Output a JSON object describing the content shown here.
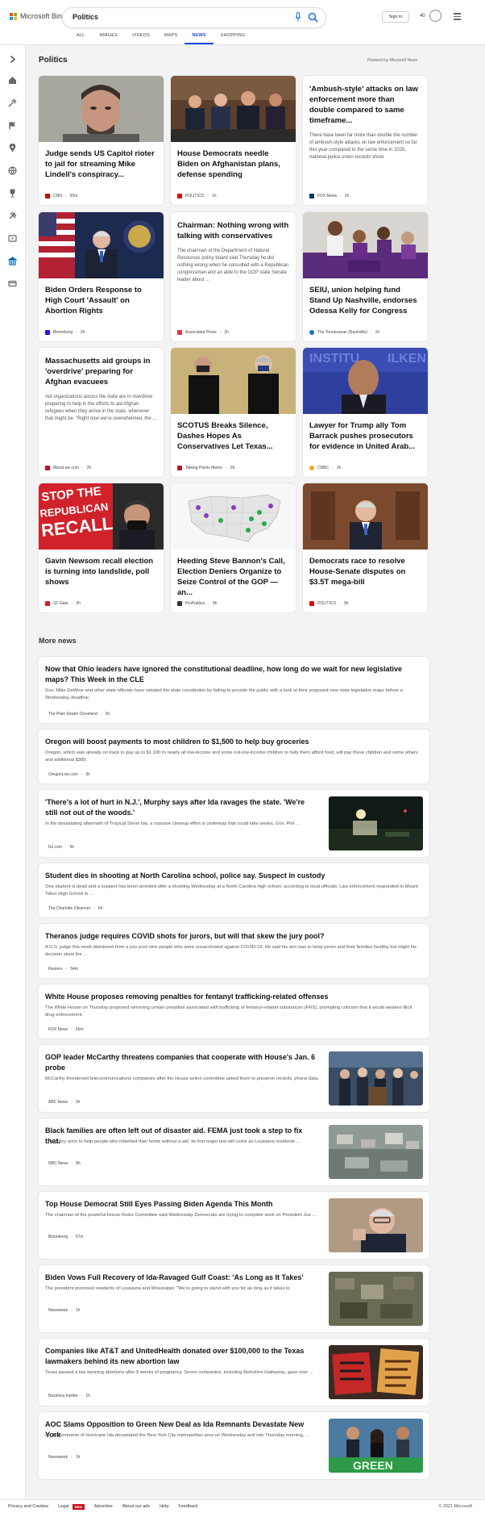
{
  "header": {
    "brand": "Microsoft Bing",
    "query": "Politics",
    "signin": "Sign in",
    "points": "40",
    "tabs": [
      "ALL",
      "IMAGES",
      "VIDEOS",
      "MAPS",
      "NEWS",
      "SHOPPING"
    ],
    "active_tab": "NEWS"
  },
  "section": {
    "title": "Politics",
    "powered_by": "Powered by Microsoft News"
  },
  "cards": [
    {
      "title": "Judge sends US Capitol rioter to jail for streaming Mike Lindell's conspiracy...",
      "source": "CNN",
      "time": "55m",
      "fav": "#cc0000",
      "img": "mugshot"
    },
    {
      "title": "House Democrats needle Biden on Afghanistan plans, defense spending",
      "source": "POLITICO",
      "time": "1h",
      "fav": "#d00",
      "img": "hearing"
    },
    {
      "title": "'Ambush-style' attacks on law enforcement more than double compared to same timeframe...",
      "snippet": "There have been far more than double the number of ambush-style attacks on law enforcement so far this year compared to the same time in 2020, national police union records show.",
      "source": "FOX News",
      "time": "2h",
      "fav": "#003366"
    },
    {
      "title": "Biden Orders Response to High Court 'Assault' on Abortion Rights",
      "source": "Bloomberg",
      "time": "2h",
      "fav": "#3a00ff",
      "img": "biden"
    },
    {
      "title": "Chairman: Nothing wrong with talking with conservatives",
      "snippet": "The chairman of the Department of Natural Resources policy board said Thursday he did nothing wrong when he consulted with a Republican congressman and an aide to the GOP state Senate leader about ...",
      "source": "Associated Press",
      "time": "2h",
      "fav": "#e03a3e"
    },
    {
      "title": "SEIU, union helping fund Stand Up Nashville, endorses Odessa Kelly for Congress",
      "source": "The Tennessean (Nashville)",
      "time": "1h",
      "fav": "#1a6fd1",
      "img": "rally"
    },
    {
      "title": "Massachusetts aid groups in 'overdrive' preparing for Afghan evacuees",
      "snippet": "Aid organizations across the state are in overdrive preparing to help in the efforts to aid Afghan refugees when they arrive in the state, whenever that might be. \"Right now we're overwhelmed, the ...",
      "source": "MassLive.com",
      "time": "2h",
      "fav": "#c8102e"
    },
    {
      "title": "SCOTUS Breaks Silence, Dashes Hopes As Conservatives Let Texas...",
      "source": "Talking Points Memo",
      "time": "2h",
      "fav": "#b01e23",
      "img": "scotus"
    },
    {
      "title": "Lawyer for Trump ally Tom Barrack pushes prosecutors for evidence in United Arab...",
      "source": "CNBC",
      "time": "2h",
      "fav": "#f5a623",
      "img": "barrack"
    },
    {
      "title": "Gavin Newsom recall election is turning into landslide, poll shows",
      "source": "SF Gate",
      "time": "3h",
      "fav": "#d71920",
      "img": "recall"
    },
    {
      "title": "Heeding Steve Bannon's Call, Election Deniers Organize to Seize Control of the GOP — an...",
      "source": "ProPublica",
      "time": "9h",
      "fav": "#333333",
      "img": "map"
    },
    {
      "title": "Democrats race to resolve House-Senate disputes on $3.5T mega-bill",
      "source": "POLITICO",
      "time": "9h",
      "fav": "#d00",
      "img": "wyden"
    }
  ],
  "more": {
    "title": "More news",
    "items": [
      {
        "title": "Now that Ohio leaders have ignored the constitutional deadline, how long do we wait for new legislative maps? This Week in the CLE",
        "snippet": "Gov. Mike DeWine and other state officials have violated the state constitution by failing to provide the public with a look at their proposed new state legislative maps before a Wednesday deadline.",
        "source": "The Plain Dealer Cleveland",
        "time": "3h",
        "fav": "#1b4f8a"
      },
      {
        "title": "Oregon will boost payments to most children to $1,500 to help buy groceries",
        "snippet": "Oregon, which was already on track to pay up to $1,100 to nearly all low-income and some not-low-income children to help them afford food, will pay those children and some others and additional $389.",
        "source": "OregonLive.com",
        "time": "3h",
        "fav": "#222222"
      },
      {
        "title": "'There's a lot of hurt in N.J.', Murphy says after Ida ravages the state. 'We're still not out of the woods.'",
        "snippet": "In the devastating aftermath of Tropical Storm Ida, a massive cleanup effort is underway that could take weeks, Gov. Phil ...",
        "source": "NJ.com",
        "time": "5h",
        "fav": "#444444",
        "img": "flood-night"
      },
      {
        "title": "Student dies in shooting at North Carolina school, police say. Suspect in custody",
        "snippet": "One student is dead and a suspect has been arrested after a shooting Wednesday at a North Carolina high school, according to local officials. Law enforcement responded to Mount Tabor High School in ...",
        "source": "The Charlotte Observer",
        "time": "6h",
        "fav": "#1f74c7"
      },
      {
        "title": "Theranos judge requires COVID shots for jurors, but will that skew the jury pool?",
        "snippet": "A U.S. judge this week dismissed from a jury pool nine people who were unvaccinated against COVID-19. He said his aim was to keep jurors and their families healthy but might his decision skew the ...",
        "source": "Reuters",
        "time": "54m",
        "fav": "#ff8000"
      },
      {
        "title": "White House proposes removing penalties for fentanyl trafficking-related offenses",
        "snippet": "The White House on Thursday proposed removing certain penalties associated with trafficking of fentanyl-related substances (FRS), prompting criticism that it would weaken illicit drug enforcement.",
        "source": "FOX News",
        "time": "55m",
        "fav": "#003366"
      },
      {
        "title": "GOP leader McCarthy threatens companies that cooperate with House's Jan. 6 probe",
        "snippet": "McCarthy threatened telecommunications companies after the House select committee asked them to preserve records, phone data.",
        "source": "ABC News",
        "time": "3h",
        "fav": "#111111",
        "img": "podium"
      },
      {
        "title": "Black families are often left out of disaster aid. FEMA just took a step to fix that.",
        "snippet": "The policy aims to help people who inherited their home without a will. Its first major test will come as Louisiana residents ...",
        "source": "NBC News",
        "time": "8h",
        "fav": "#333333",
        "img": "aerial"
      },
      {
        "title": "Top House Democrat Still Eyes Passing Biden Agenda This Month",
        "snippet": "The chairman of the powerful House Rules Committee said Wednesday Democrats are trying to complete work on President Joe ...",
        "source": "Bloomberg",
        "time": "57m",
        "fav": "#3a00ff",
        "img": "mcgovern"
      },
      {
        "title": "Biden Vows Full Recovery of Ida-Ravaged Gulf Coast: 'As Long as It Takes'",
        "snippet": "The president promised residents of Louisiana and Mississippi: \"We're going to stand with you for as long as it takes to",
        "source": "Newsweek",
        "time": "1h",
        "fav": "#d71920",
        "img": "damage"
      },
      {
        "title": "Companies like AT&T and UnitedHealth donated over $100,000 to the Texas lawmakers behind its new abortion law",
        "snippet": "Texas passed a law banning abortions after 6 weeks of pregnancy. Seven companies, including Berkshire Hathaway, gave over ...",
        "source": "Business Insider",
        "time": "1h",
        "fav": "#1a5de0",
        "img": "signs"
      },
      {
        "title": "AOC Slams Opposition to Green New Deal as Ida Remnants Devastate New York",
        "snippet": "As the remnants of Hurricane Ida devastated the New York City metropolitan area on Wednesday and into Thursday morning, ...",
        "source": "Newsweek",
        "time": "1h",
        "fav": "#d71920",
        "img": "aoc"
      }
    ]
  },
  "footer": {
    "links": [
      "Privacy and Cookies",
      "Legal",
      "Advertise",
      "About our ads",
      "Help",
      "Feedback"
    ],
    "new_badge": "New",
    "copyright": "© 2021 Microsoft"
  }
}
